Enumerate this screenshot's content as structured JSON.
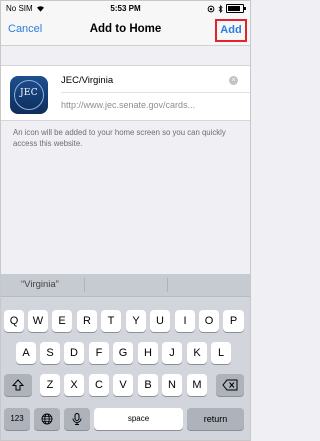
{
  "status_bar": {
    "carrier": "No SIM",
    "time": "5:53 PM"
  },
  "nav": {
    "cancel_label": "Cancel",
    "title": "Add to Home",
    "add_label": "Add"
  },
  "bookmark": {
    "icon_text": "JEC",
    "name": "JEC/Virginia",
    "url": "http://www.jec.senate.gov/cards..."
  },
  "note": "An icon will be added to your home screen so you can quickly access this website.",
  "keyboard": {
    "suggestions": [
      "“Virginia”",
      "",
      ""
    ],
    "row1": [
      "Q",
      "W",
      "E",
      "R",
      "T",
      "Y",
      "U",
      "I",
      "O",
      "P"
    ],
    "row2": [
      "A",
      "S",
      "D",
      "F",
      "G",
      "H",
      "J",
      "K",
      "L"
    ],
    "row3": [
      "Z",
      "X",
      "C",
      "V",
      "B",
      "N",
      "M"
    ],
    "numbers_label": "123",
    "space_label": "space",
    "return_label": "return"
  },
  "colors": {
    "accent": "#2a7de1",
    "highlight": "#e0242a"
  }
}
